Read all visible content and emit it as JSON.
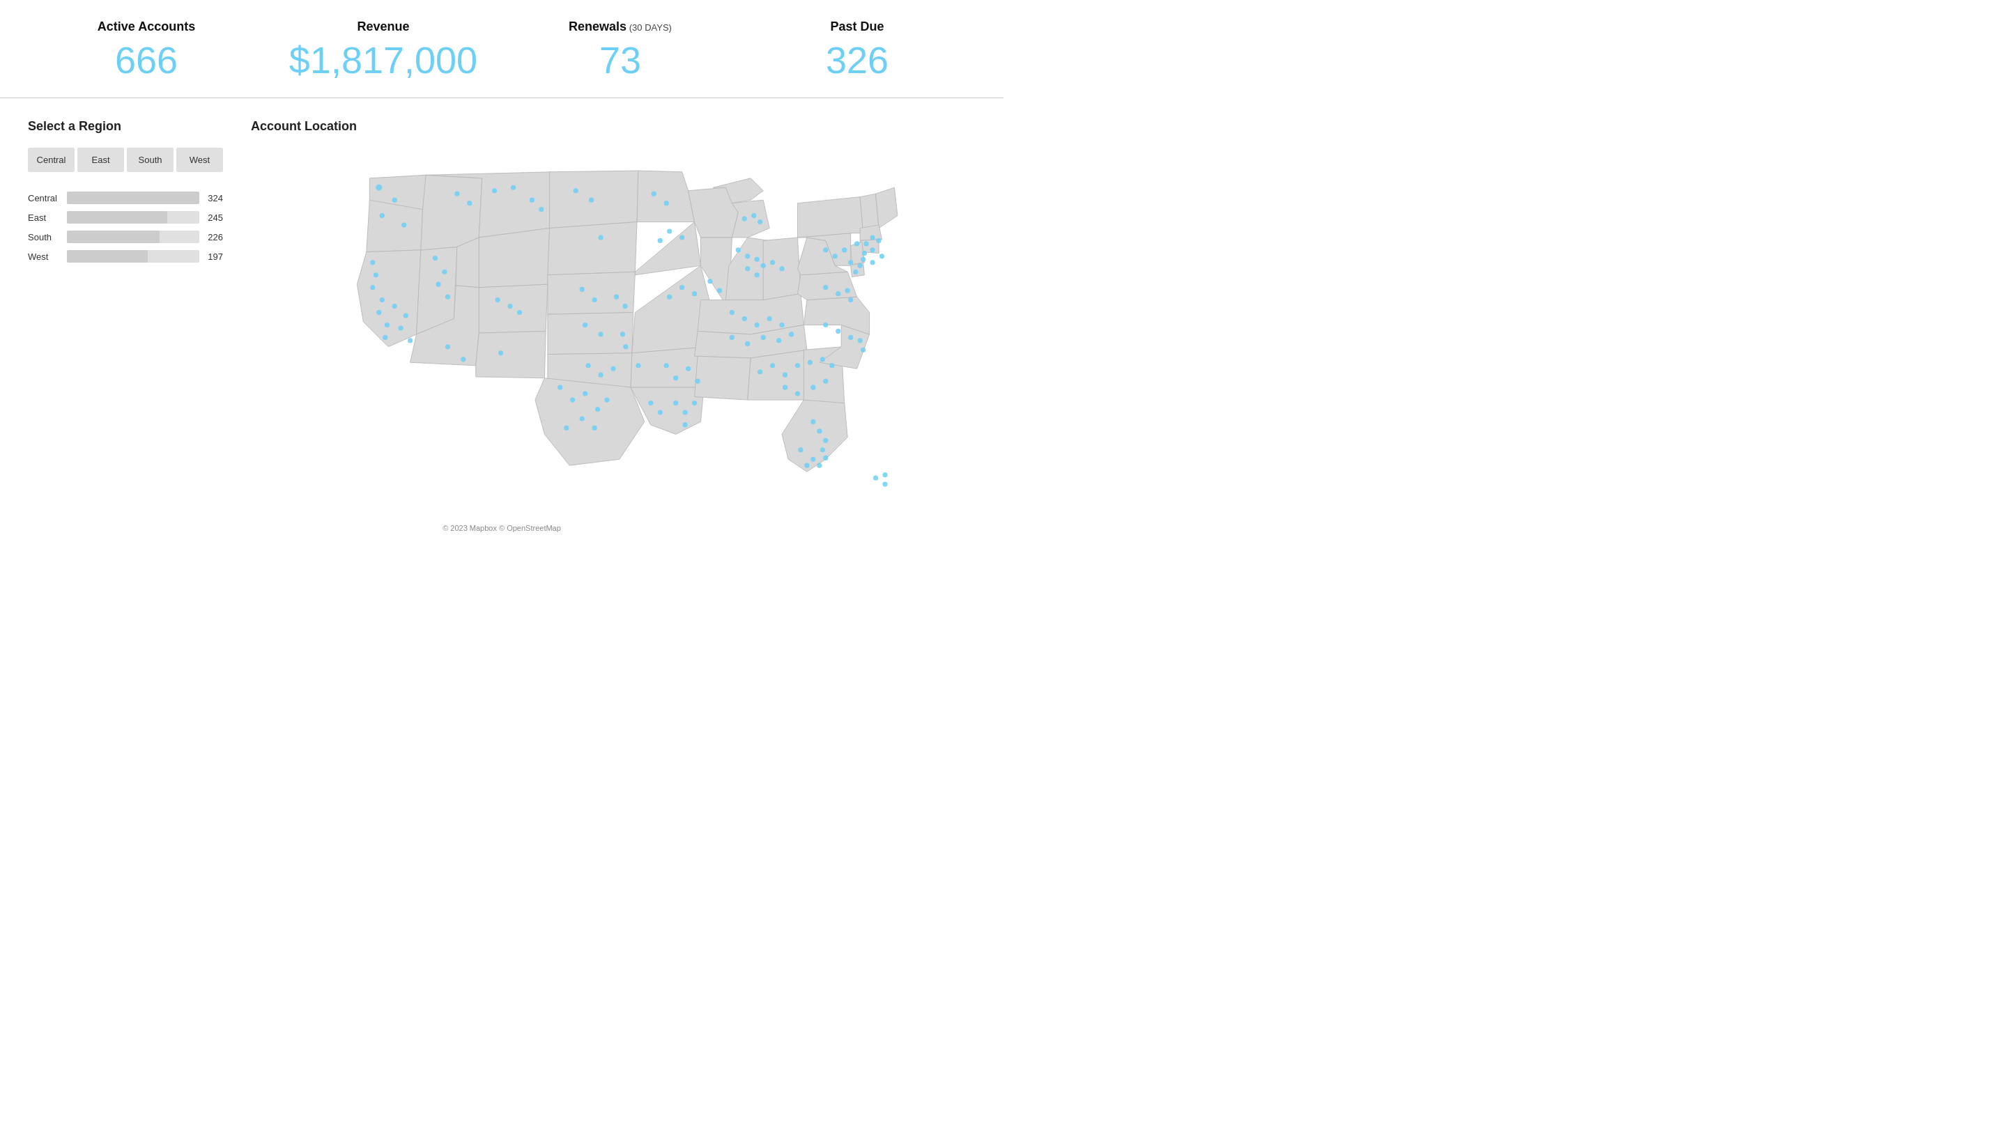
{
  "header": {
    "stats": [
      {
        "id": "active-accounts",
        "label": "Active Accounts",
        "value": "666",
        "days_tag": null
      },
      {
        "id": "revenue",
        "label": "Revenue",
        "value": "$1,817,000",
        "days_tag": null
      },
      {
        "id": "renewals",
        "label": "Renewals",
        "value": "73",
        "days_tag": "(30 DAYS)"
      },
      {
        "id": "past-due",
        "label": "Past Due",
        "value": "326",
        "days_tag": null
      }
    ]
  },
  "region_section": {
    "title": "Select a Region",
    "buttons": [
      {
        "id": "central",
        "label": "Central"
      },
      {
        "id": "east",
        "label": "East"
      },
      {
        "id": "south",
        "label": "South"
      },
      {
        "id": "west",
        "label": "West"
      }
    ],
    "bars": [
      {
        "id": "central",
        "label": "Central",
        "value": 324,
        "max": 324
      },
      {
        "id": "east",
        "label": "East",
        "value": 245,
        "max": 324
      },
      {
        "id": "south",
        "label": "South",
        "value": 226,
        "max": 324
      },
      {
        "id": "west",
        "label": "West",
        "value": 197,
        "max": 324
      }
    ]
  },
  "map_section": {
    "title": "Account Location",
    "footer": "© 2023 Mapbox © OpenStreetMap"
  },
  "colors": {
    "accent": "#6dcff6",
    "bar": "#cccccc",
    "bar_bg": "#e0e0e0",
    "btn_bg": "#e0e0e0",
    "map_fill": "#d8d8d8",
    "map_stroke": "#b0b0b0",
    "dot": "#6dcff6"
  }
}
